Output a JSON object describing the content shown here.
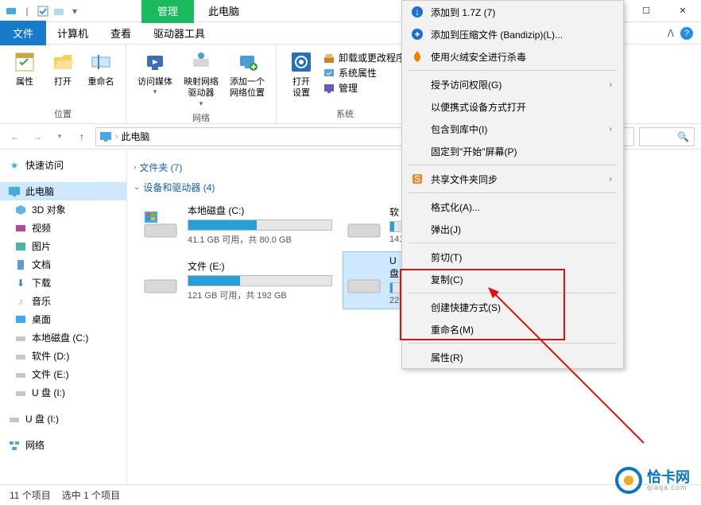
{
  "titlebar": {
    "manage_tab": "管理",
    "title_tab": "此电脑"
  },
  "menubar": {
    "file": "文件",
    "computer": "计算机",
    "view": "查看",
    "drive_tools": "驱动器工具"
  },
  "ribbon": {
    "loc": {
      "properties": "属性",
      "open": "打开",
      "rename": "重命名",
      "label": "位置"
    },
    "net": {
      "access_media": "访问媒体",
      "map_drive": "映射网络\n驱动器",
      "add_net": "添加一个\n网络位置",
      "label": "网络"
    },
    "sys": {
      "open_settings": "打开\n设置",
      "uninstall": "卸载或更改程序",
      "sys_props": "系统属性",
      "manage": "管理",
      "label": "系统"
    }
  },
  "addr": {
    "path": "此电脑"
  },
  "sidebar": {
    "quick": "快速访问",
    "thispc": "此电脑",
    "obj3d": "3D 对象",
    "video": "视频",
    "pics": "图片",
    "docs": "文档",
    "dl": "下载",
    "music": "音乐",
    "desktop": "桌面",
    "localc": "本地磁盘 (C:)",
    "softd": "软件 (D:)",
    "filese": "文件 (E:)",
    "ui1": "U 盘 (I:)",
    "ui2": "U 盘 (I:)",
    "network": "网络"
  },
  "sections": {
    "folders": "文件夹 (7)",
    "drives": "设备和驱动器 (4)"
  },
  "drives": {
    "c": {
      "name": "本地磁盘 (C:)",
      "space": "41.1 GB 可用，共 80.0 GB"
    },
    "d": {
      "name": "软",
      "space": "141"
    },
    "e": {
      "name": "文件 (E:)",
      "space": "121 GB 可用，共 192 GB"
    },
    "u": {
      "name": "U 盘",
      "space": "22."
    }
  },
  "ctx": {
    "addto": "添加到 1.7Z (7)",
    "addzip": "添加到压缩文件 (Bandizip)(L)...",
    "huorong": "使用火绒安全进行杀毒",
    "access": "授予访问权限(G)",
    "portable": "以便携式设备方式打开",
    "library": "包含到库中(I)",
    "pin": "固定到\"开始\"屏幕(P)",
    "sync": "共享文件夹同步",
    "format": "格式化(A)...",
    "eject": "弹出(J)",
    "cut": "剪切(T)",
    "copy": "复制(C)",
    "shortcut": "创建快捷方式(S)",
    "rename": "重命名(M)",
    "props": "属性(R)"
  },
  "status": {
    "count": "11 个项目",
    "sel": "选中 1 个项目"
  },
  "watermark": {
    "name": "恰卡网",
    "url": "qiaqa.com"
  }
}
